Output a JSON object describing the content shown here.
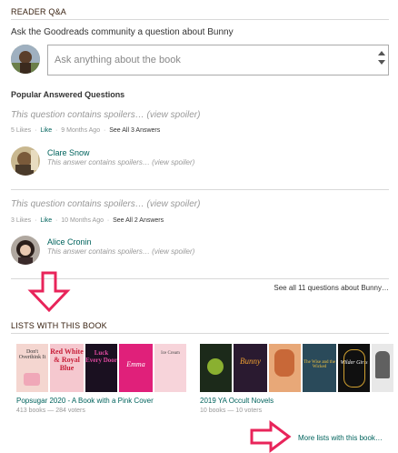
{
  "section": {
    "title": "READER Q&A"
  },
  "ask": {
    "title": "Ask the Goodreads community a question about Bunny",
    "placeholder": "Ask anything about the book"
  },
  "popular": {
    "title": "Popular Answered Questions"
  },
  "questions": [
    {
      "spoiler_text": "This question contains spoilers…",
      "view_spoiler": "(view spoiler)",
      "likes": "5 Likes",
      "like": "Like",
      "time": "9 Months Ago",
      "see_all": "See All 3 Answers",
      "answerer": "Clare Snow",
      "answer_spoiler": "This answer contains spoilers…",
      "answer_view": "(view spoiler)"
    },
    {
      "spoiler_text": "This question contains spoilers…",
      "view_spoiler": "(view spoiler)",
      "likes": "3 Likes",
      "like": "Like",
      "time": "10 Months Ago",
      "see_all": "See All 2 Answers",
      "answerer": "Alice Cronin",
      "answer_spoiler": "This answer contains spoilers…",
      "answer_view": "(view spoiler)"
    }
  ],
  "see_all_questions": "See all 11 questions about Bunny…",
  "lists": {
    "title": "LISTS WITH THIS BOOK",
    "items": [
      {
        "name": "Popsugar 2020 - A Book with a Pink Cover",
        "meta": "413 books — 284 voters",
        "covers": [
          "Don't Overthink It",
          "Red White & Royal Blue",
          "Luck Every Door",
          "Emma",
          "Ice Cream"
        ]
      },
      {
        "name": "2019 YA Occult Novels",
        "meta": "10 books — 10 voters",
        "covers": [
          "",
          "Bunny",
          "",
          "The Wise and the Wicked",
          "Wilder Girls",
          ""
        ]
      }
    ],
    "more": "More lists with this book…"
  },
  "colors": {
    "link": "#00635d",
    "arrow": "#e8245a",
    "rule": "#d8d8d8"
  }
}
